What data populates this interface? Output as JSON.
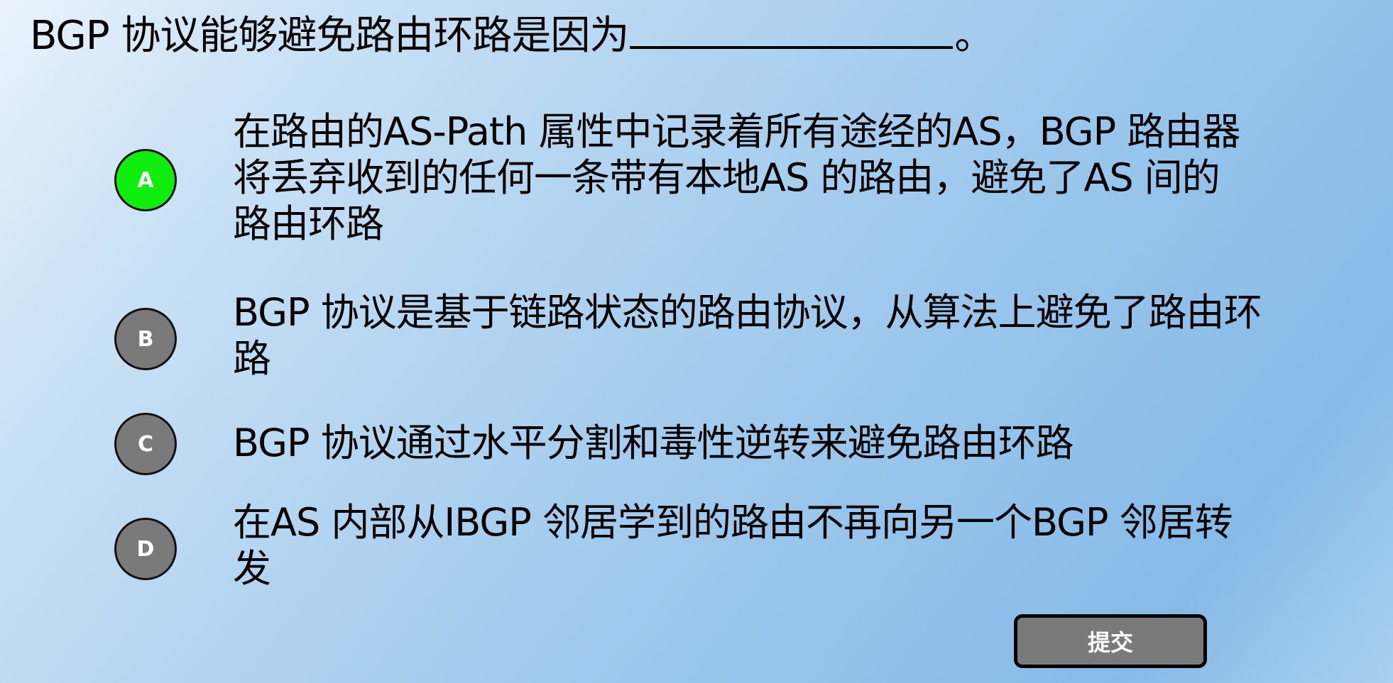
{
  "question": {
    "text": "BGP 协议能够避免路由环路是因为",
    "suffix": "。"
  },
  "options": [
    {
      "letter": "A",
      "text": "在路由的AS-Path 属性中记录着所有途经的AS，BGP 路由器将丢弃收到的任何一条带有本地AS 的路由，避免了AS 间的路由环路",
      "selected": true
    },
    {
      "letter": "B",
      "text": "BGP 协议是基于链路状态的路由协议，从算法上避免了路由环路",
      "selected": false
    },
    {
      "letter": "C",
      "text": "BGP 协议通过水平分割和毒性逆转来避免路由环路",
      "selected": false
    },
    {
      "letter": "D",
      "text": "在AS 内部从IBGP 邻居学到的路由不再向另一个BGP 邻居转发",
      "selected": false
    }
  ],
  "submit_label": "提交",
  "colors": {
    "selected": "#10ee10",
    "unselected": "#7a7a7a",
    "background": "#a9d0ef"
  }
}
